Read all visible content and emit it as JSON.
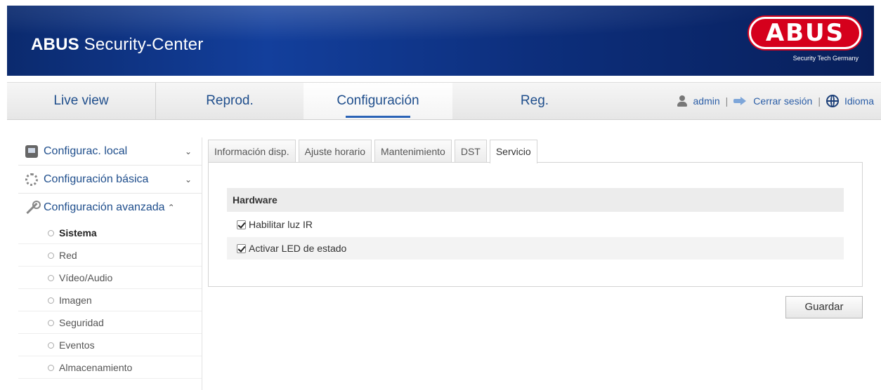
{
  "header": {
    "brand": "ABUS",
    "title_rest": " Security-Center",
    "logo_text": "ABUS",
    "logo_sub": "Security Tech Germany"
  },
  "nav": {
    "tabs": [
      {
        "label": "Live view"
      },
      {
        "label": "Reprod."
      },
      {
        "label": "Configuración"
      },
      {
        "label": "Reg."
      }
    ],
    "active_tab": "Configuración",
    "user": "admin",
    "logout": "Cerrar sesión",
    "language": "Idioma",
    "separator": "|"
  },
  "sidebar": {
    "groups": [
      {
        "label": "Configurac. local",
        "icon": "local-config-icon",
        "expanded": false
      },
      {
        "label": "Configuración básica",
        "icon": "gear-icon",
        "expanded": false
      },
      {
        "label": "Configuración avanzada",
        "icon": "wrench-icon",
        "expanded": true
      }
    ],
    "items": [
      {
        "label": "Sistema",
        "active": true
      },
      {
        "label": "Red"
      },
      {
        "label": "Vídeo/Audio"
      },
      {
        "label": "Imagen"
      },
      {
        "label": "Seguridad"
      },
      {
        "label": "Eventos"
      },
      {
        "label": "Almacenamiento"
      }
    ]
  },
  "subtabs": [
    {
      "label": "Información disp."
    },
    {
      "label": "Ajuste horario"
    },
    {
      "label": "Mantenimiento"
    },
    {
      "label": "DST"
    },
    {
      "label": "Servicio",
      "active": true
    }
  ],
  "panel": {
    "section_title": "Hardware",
    "options": [
      {
        "label": "Habilitar luz IR",
        "checked": true
      },
      {
        "label": "Activar LED de estado",
        "checked": true
      }
    ]
  },
  "buttons": {
    "save": "Guardar"
  },
  "colors": {
    "banner": "#133f9c",
    "logo_red": "#d5001c",
    "link_blue": "#1f4e8c"
  }
}
